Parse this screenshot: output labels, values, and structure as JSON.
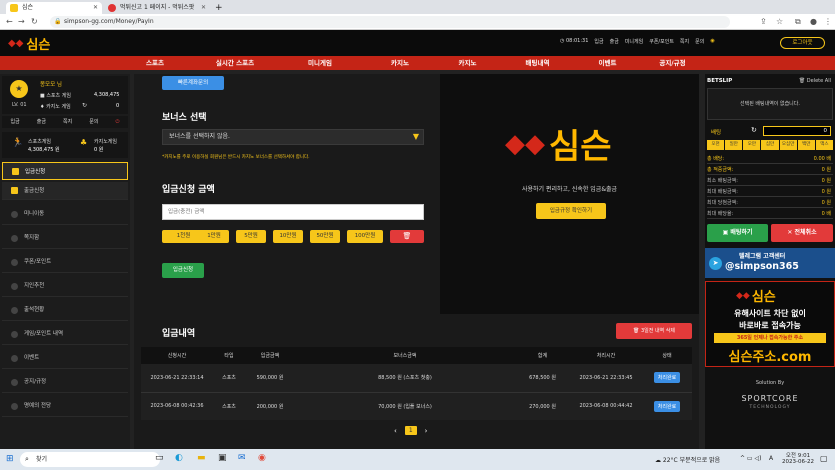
{
  "browser": {
    "tabs": [
      {
        "title": "심슨",
        "active": true
      },
      {
        "title": "먹튀신고 1 페이지 - 먹튀스팟",
        "active": false
      }
    ],
    "new_tab": "+",
    "url": "simpson-gg.com/Money/PayIn"
  },
  "header": {
    "logo": "심슨",
    "time": "08:01:31",
    "links": [
      "입금",
      "출금",
      "미니게임",
      "쿠폰/포인트",
      "쪽지",
      "문의"
    ],
    "logout": "로그아웃"
  },
  "nav": [
    "스포츠",
    "실시간 스포츠",
    "미니게임",
    "카지노",
    "카지노",
    "배팅내역",
    "이벤트",
    "공지/규정"
  ],
  "user": {
    "name": "몽모모 님",
    "level": "LV. 01",
    "sports_money_label": "스포츠 게임",
    "sports_money": "4,308,475",
    "casino_money_label": "카지노 게임",
    "casino_money": "0",
    "quick": [
      "입금",
      "출금",
      "쪽지",
      "문의"
    ],
    "wallet1_label": "스포츠게임",
    "wallet1_value": "4,308,475 원",
    "wallet2_label": "카지노게임",
    "wallet2_value": "0 원"
  },
  "sidebar": {
    "items": [
      "입금신청",
      "출금신청",
      "미니이동",
      "쪽지함",
      "쿠폰/포인트",
      "지인추천",
      "출석현황",
      "게임/포인트 내역",
      "이벤트",
      "공지/규정",
      "명예의 전당"
    ]
  },
  "payin": {
    "quick_button": "빠른계좌문의",
    "bonus_title": "보너스 선택",
    "bonus_select": "보너스를 선택하지 않음.",
    "bonus_note": "*카지노를 주로 이용하실 회원님은 반드시 카지노 보너스를 선택하셔야 합니다.",
    "amount_title": "입금신청 금액",
    "amount_placeholder": "입금(충전) 금액",
    "amounts": [
      "1천원",
      "1만원",
      "5만원",
      "10만원",
      "50만원",
      "100만원"
    ],
    "submit": "입금신청"
  },
  "promo": {
    "logo": "심슨",
    "tagline": "사용하기 편리하고, 신속한 입금&출금",
    "button": "입금규정 확인하기"
  },
  "history": {
    "title": "입금내역",
    "delete_button": "3일전 내역 삭제",
    "columns": [
      "신청시간",
      "타입",
      "입금금액",
      "보너스금액",
      "합계",
      "처리시간",
      "상태"
    ],
    "rows": [
      [
        "2023-06-21 22:33:14",
        "스포츠",
        "590,000 원",
        "88,500 원 (스포츠 첫충)",
        "678,500 원",
        "2023-06-21 22:33:45",
        "처리완료"
      ],
      [
        "2023-06-08 00:42:36",
        "스포츠",
        "200,000 원",
        "70,000 원 (입플 보너스)",
        "270,000 원",
        "2023-06-08 00:44:42",
        "처리완료"
      ]
    ],
    "pages": [
      "‹",
      "1",
      "›"
    ]
  },
  "betslip": {
    "title": "BETSLIP",
    "delete_all": "Delete All",
    "empty": "선택된 배팅내역이 없습니다.",
    "amount_label": "배팅",
    "amount_value": "0",
    "quick": [
      "오천",
      "일만",
      "오만",
      "십만",
      "오십만",
      "백만",
      "맥스"
    ],
    "rows": [
      {
        "label": "총 배당:",
        "value": "0.00 배"
      },
      {
        "label": "총 적중금액:",
        "value": "0 원"
      },
      {
        "label": "최소 배팅금액:",
        "value": "0 원"
      },
      {
        "label": "최대 배팅금액:",
        "value": "0 원"
      },
      {
        "label": "최대 당첨금액:",
        "value": "0 원"
      },
      {
        "label": "최대 배당율:",
        "value": "0 배"
      }
    ],
    "bet_button": "배팅하기",
    "clear_button": "전체취소"
  },
  "banners": {
    "telegram_title": "텔레그램 고객센터",
    "telegram_handle": "@simpson365",
    "ad_logo": "심슨",
    "ad_line1": "유해사이트 차단 없이",
    "ad_line2": "바로바로 접속가능",
    "ad_line3": "365일 언제나 접속가능한 주소",
    "ad_domain": "심슨주소.com",
    "solution_by": "Solution By",
    "sportcore": "SPORTCORE",
    "sportcore_sub": "TECHNOLOGY"
  },
  "taskbar": {
    "search": "찾기",
    "weather": "22°C 부분적으로 맑음",
    "ime": "A",
    "time": "오전 9:01",
    "date": "2023-06-22"
  },
  "colors": {
    "accent": "#c42416",
    "gold": "#f7c61a",
    "green": "#2aa04a",
    "red": "#e23a3a"
  }
}
